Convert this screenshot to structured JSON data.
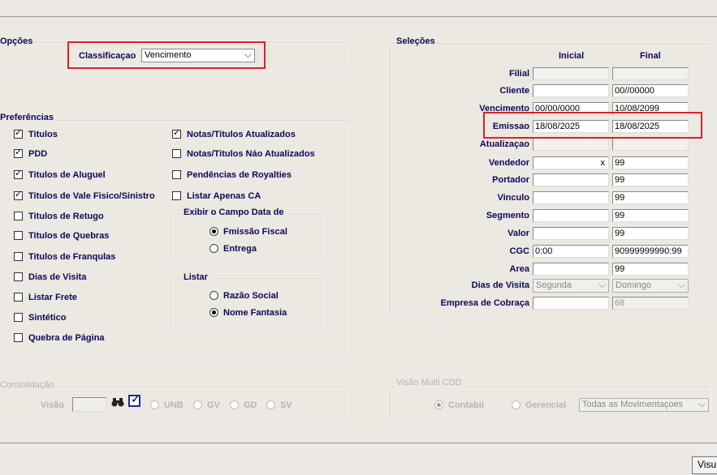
{
  "opcoes": {
    "title": "Opções",
    "classificacao_label": "Classificaçao",
    "classificacao_value": "Vencimento"
  },
  "preferencias": {
    "title": "Preferências",
    "left": [
      {
        "label": "Titulos",
        "checked": true
      },
      {
        "label": "PDD",
        "checked": true
      },
      {
        "label": "Titulos de Aluguel",
        "checked": true
      },
      {
        "label": "Titulos de Vale Fisico/Sinistro",
        "checked": true
      },
      {
        "label": "Titulos de Retugo",
        "checked": false
      },
      {
        "label": "Titulos de Quebras",
        "checked": false
      },
      {
        "label": "Titulos de Franqulas",
        "checked": false
      },
      {
        "label": "Dias de Visita",
        "checked": false
      },
      {
        "label": "Listar Frete",
        "checked": false
      },
      {
        "label": "Sintético",
        "checked": false
      },
      {
        "label": "Quebra de Página",
        "checked": false
      }
    ],
    "right": [
      {
        "label": "Notas/Titulos Atualizados",
        "checked": true
      },
      {
        "label": "Notas/Titulos Náo Atualizados",
        "checked": false
      },
      {
        "label": "Pendências de Royalties",
        "checked": false
      },
      {
        "label": "Listar Apenas CA",
        "checked": false
      }
    ],
    "exibir_title": "Exibir o Campo Data de",
    "exibir_options": [
      {
        "label": "Fmissão Fiscal",
        "selected": true
      },
      {
        "label": "Entrega",
        "selected": false
      }
    ],
    "listar_title": "Listar",
    "listar_options": [
      {
        "label": "Razão Social",
        "selected": false
      },
      {
        "label": "Nome Fantasia",
        "selected": true
      }
    ]
  },
  "selecoes": {
    "title": "Seleções",
    "col_inicial": "Inicial",
    "col_final": "Final",
    "rows": [
      {
        "label": "Filial",
        "inicial": "",
        "final": ""
      },
      {
        "label": "Cliente",
        "inicial": "",
        "final": "00//00000"
      },
      {
        "label": "Vencimento",
        "inicial": "00/00/0000",
        "final": "10/08/2099"
      },
      {
        "label": "Emissao",
        "inicial": "18/08/2025",
        "final": "18/08/2025"
      },
      {
        "label": "Atualizaçao",
        "inicial": "",
        "final": ""
      },
      {
        "label": "Vendedor",
        "inicial": "x",
        "final": "99"
      },
      {
        "label": "Portador",
        "inicial": "",
        "final": "99"
      },
      {
        "label": "Vinculo",
        "inicial": "",
        "final": "99"
      },
      {
        "label": "Segmento",
        "inicial": "",
        "final": "99"
      },
      {
        "label": "Valor",
        "inicial": "",
        "final": "99"
      },
      {
        "label": "CGC",
        "inicial": "0:00",
        "final": "90999999990:99"
      },
      {
        "label": "Area",
        "inicial": "",
        "final": "99"
      },
      {
        "label": "Dias de Visita",
        "inicial": "Segunda",
        "final": "Domingo"
      },
      {
        "label": "Empresa de Cobraça",
        "inicial": "",
        "final": "68"
      }
    ]
  },
  "consolidacao": {
    "title": "Consolidação",
    "visao_label": "Visão",
    "options": [
      "UNB",
      "GV",
      "GD",
      "SV"
    ]
  },
  "visao_multi": {
    "title": "Visão Multi CDD",
    "options": [
      {
        "label": "Contabil",
        "selected": true
      },
      {
        "label": "Gerencial",
        "selected": false
      }
    ],
    "select_value": "Todas as Movimentaçoes"
  },
  "bottom": {
    "button_label": "Visu"
  },
  "icons": {
    "binoculars": "binoculars-icon",
    "check": "checkbox-icon"
  }
}
